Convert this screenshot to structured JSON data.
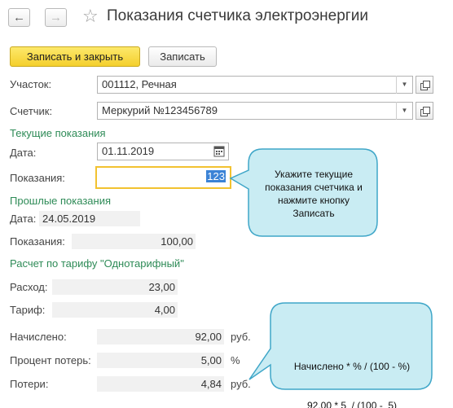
{
  "header": {
    "title": "Показания счетчика электроэнергии",
    "back_icon": "arrow-left",
    "forward_icon": "arrow-right",
    "favorite_icon": "star"
  },
  "toolbar": {
    "save_close_label": "Записать и закрыть",
    "save_label": "Записать"
  },
  "form": {
    "section_label": "Участок:",
    "section_value": "001112, Речная",
    "meter_label": "Счетчик:",
    "meter_value": "Меркурий №123456789",
    "current_title": "Текущие показания",
    "date_label": "Дата:",
    "date_value": "01.11.2019",
    "reading_label": "Показания:",
    "reading_value": "123",
    "previous_title": "Прошлые показания",
    "prev_date_label": "Дата:",
    "prev_date_value": "24.05.2019",
    "prev_reading_label": "Показания:",
    "prev_reading_value": "100,00",
    "tariff_title": "Расчет по тарифу \"Однотарифный\"",
    "consumption_label": "Расход:",
    "consumption_value": "23,00",
    "tariff_label": "Тариф:",
    "tariff_value": "4,00",
    "charged_label": "Начислено:",
    "charged_value": "92,00",
    "charged_unit": "руб.",
    "loss_pct_label": "Процент потерь:",
    "loss_pct_value": "5,00",
    "loss_pct_unit": "%",
    "losses_label": "Потери:",
    "losses_value": "4,84",
    "losses_unit": "руб."
  },
  "callouts": {
    "hint_line1": "Укажите текущие",
    "hint_line2": "показания счетчика и",
    "hint_line3": "нажмите кнопку",
    "hint_line4": "Записать",
    "formula_line1": "Начислено * % / (100 - %)",
    "formula_line2": "92,00 * 5  / (100 -  5)"
  },
  "colors": {
    "primary_button": "#f4cf2d",
    "section_title": "#2e8b57",
    "callout_fill": "#c9ecf3",
    "callout_border": "#3fa6c8",
    "active_border": "#f2c230",
    "selection": "#3b83d6"
  }
}
